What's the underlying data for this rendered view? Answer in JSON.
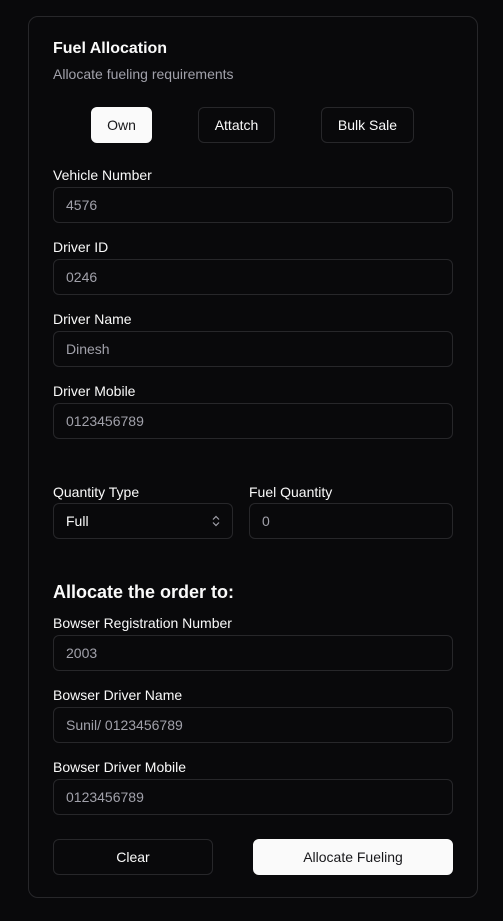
{
  "form": {
    "title": "Fuel Allocation",
    "subtitle": "Allocate fueling requirements",
    "tabs": [
      {
        "label": "Own",
        "active": true
      },
      {
        "label": "Attatch",
        "active": false
      },
      {
        "label": "Bulk Sale",
        "active": false
      }
    ],
    "fields": {
      "vehicle_number": {
        "label": "Vehicle Number",
        "value": "4576"
      },
      "driver_id": {
        "label": "Driver ID",
        "value": "0246"
      },
      "driver_name": {
        "label": "Driver Name",
        "value": "Dinesh"
      },
      "driver_mobile": {
        "label": "Driver Mobile",
        "value": "0123456789"
      },
      "quantity_type": {
        "label": "Quantity Type",
        "value": "Full"
      },
      "fuel_quantity": {
        "label": "Fuel Quantity",
        "value": "0"
      }
    },
    "allocate_section": {
      "title": "Allocate the order to:",
      "bowser_registration": {
        "label": "Bowser Registration Number",
        "value": "2003"
      },
      "bowser_driver_name": {
        "label": "Bowser Driver Name",
        "value": "Sunil/ 0123456789"
      },
      "bowser_driver_mobile": {
        "label": "Bowser Driver Mobile",
        "value": "0123456789"
      }
    },
    "actions": {
      "clear_label": "Clear",
      "allocate_label": "Allocate Fueling"
    }
  },
  "colors": {
    "background": "#09090b",
    "border": "#27272a",
    "text": "#fafafa",
    "muted": "#a1a1aa",
    "primary_bg": "#fafafa",
    "primary_text": "#18181b"
  }
}
